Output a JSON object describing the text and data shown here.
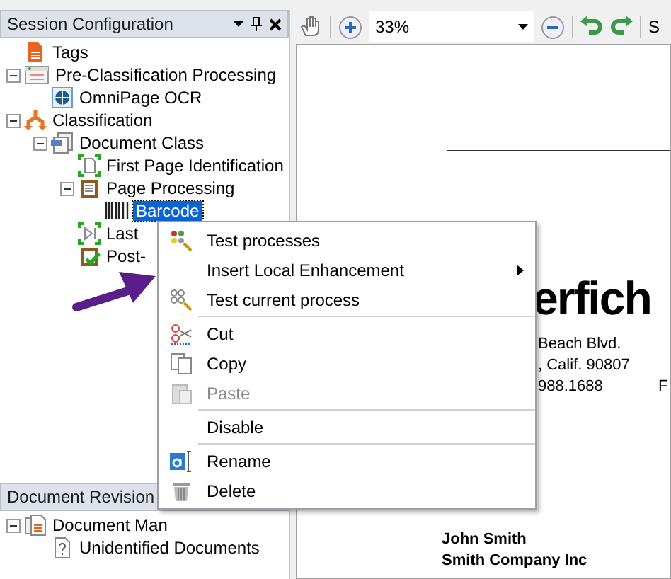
{
  "session_panel": {
    "title": "Session Configuration",
    "tree": [
      {
        "label": "Tags",
        "kind": "tags",
        "selected": false
      },
      {
        "label": "Pre-Classification Processing",
        "kind": "process",
        "expanded": true,
        "selected": false,
        "children": [
          {
            "label": "OmniPage OCR",
            "kind": "ocr",
            "selected": false
          }
        ]
      },
      {
        "label": "Classification",
        "kind": "classification",
        "expanded": true,
        "selected": false,
        "children": [
          {
            "label": "Document Class",
            "kind": "class",
            "expanded": true,
            "selected": false,
            "children": [
              {
                "label": "First Page Identification",
                "kind": "identification",
                "selected": false
              },
              {
                "label": "Page Processing",
                "kind": "page",
                "expanded": true,
                "selected": false,
                "children": [
                  {
                    "label": "Barcode",
                    "kind": "barcode",
                    "selected": true
                  }
                ]
              },
              {
                "label": "Last",
                "kind": "last",
                "selected": false
              },
              {
                "label": "Post-",
                "kind": "post",
                "selected": false
              }
            ]
          }
        ]
      }
    ]
  },
  "revision_panel": {
    "title": "Document Revision",
    "tree": [
      {
        "label": "Document Man",
        "kind": "manager",
        "expanded": true,
        "selected": false,
        "children": [
          {
            "label": "Unidentified Documents",
            "kind": "unknown",
            "selected": false
          }
        ]
      }
    ]
  },
  "toolbar": {
    "zoom": "33%",
    "cut_text": "S"
  },
  "document": {
    "heading": "erfich",
    "lines": [
      "Beach Blvd.",
      ", Calif. 90807",
      "988.1688"
    ],
    "fax": "F",
    "recipient": [
      "John Smith",
      "Smith Company Inc"
    ]
  },
  "context_menu": {
    "groups": [
      [
        {
          "label": "Test processes",
          "kind": "test",
          "disabled": false,
          "submenu": false
        },
        {
          "label": "Insert Local Enhancement",
          "kind": "none",
          "disabled": false,
          "submenu": true
        },
        {
          "label": "Test current process",
          "kind": "test-current",
          "disabled": false,
          "submenu": false
        }
      ],
      [
        {
          "label": "Cut",
          "kind": "cut",
          "disabled": false,
          "submenu": false
        },
        {
          "label": "Copy",
          "kind": "copy",
          "disabled": false,
          "submenu": false
        },
        {
          "label": "Paste",
          "kind": "paste",
          "disabled": true,
          "submenu": false
        }
      ],
      [
        {
          "label": "Disable",
          "kind": "none",
          "disabled": false,
          "submenu": false
        }
      ],
      [
        {
          "label": "Rename",
          "kind": "rename",
          "disabled": false,
          "submenu": false
        },
        {
          "label": "Delete",
          "kind": "delete",
          "disabled": false,
          "submenu": false
        }
      ]
    ]
  }
}
